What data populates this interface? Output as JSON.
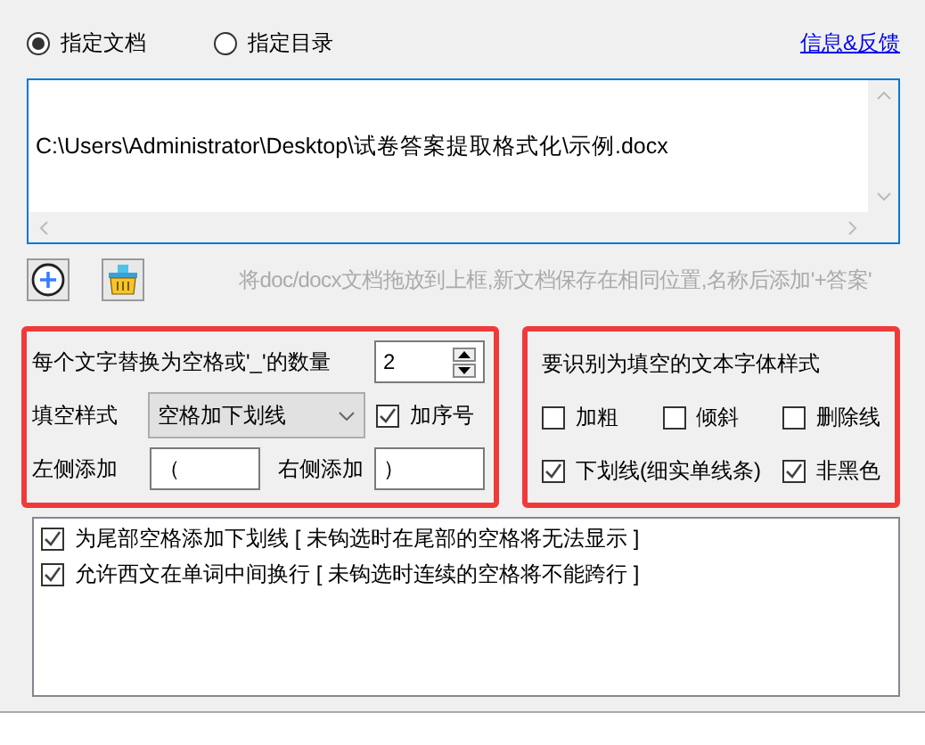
{
  "source_mode": [
    {
      "label": "指定文档",
      "selected": true
    },
    {
      "label": "指定目录",
      "selected": false
    }
  ],
  "feedback_link": "信息&反馈",
  "path_box": {
    "value": "C:\\Users\\Administrator\\Desktop\\试卷答案提取格式化\\示例.docx"
  },
  "hint": "将doc/docx文档拖放到上框,新文档保存在相同位置,名称后添加'+答案'",
  "fill_settings": {
    "count_label": "每个文字替换为空格或'_'的数量",
    "count_value": "2",
    "style_label": "填空样式",
    "style_value": "空格加下划线",
    "numbering": {
      "label": "加序号",
      "checked": true
    },
    "left_label": "左侧添加",
    "left_value": "（",
    "right_label": "右侧添加",
    "right_value": "）"
  },
  "font_styles": {
    "title": "要识别为填空的文本字体样式",
    "options": [
      {
        "label": "加粗",
        "checked": false
      },
      {
        "label": "倾斜",
        "checked": false
      },
      {
        "label": "删除线",
        "checked": false
      },
      {
        "label": "下划线(细实单线条)",
        "checked": true
      },
      {
        "label": "非黑色",
        "checked": true
      }
    ]
  },
  "extra_options": [
    {
      "label": "为尾部空格添加下划线 [ 未钩选时在尾部的空格将无法显示 ]",
      "checked": true
    },
    {
      "label": "允许西文在单词中间换行 [ 未钩选时连续的空格将不能跨行 ]",
      "checked": true
    }
  ]
}
